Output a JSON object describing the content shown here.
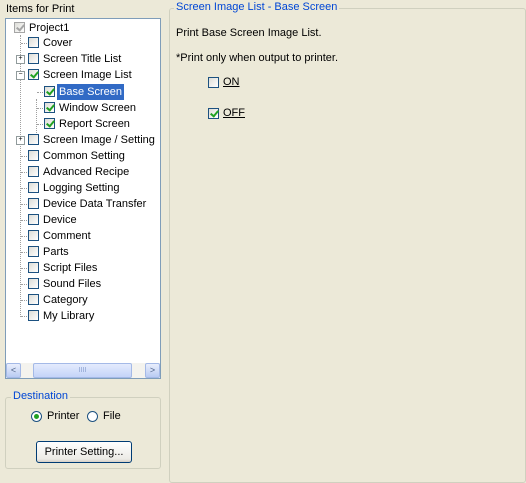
{
  "left": {
    "title": "Items for Print",
    "tree": [
      {
        "label": "Project1",
        "checked": true,
        "gray": true
      },
      {
        "label": "Cover",
        "checked": false
      },
      {
        "label": "Screen Title List",
        "checked": false
      },
      {
        "label": "Screen Image List",
        "checked": true
      },
      {
        "label": "Base Screen",
        "checked": true,
        "selected": true
      },
      {
        "label": "Window Screen",
        "checked": true
      },
      {
        "label": "Report Screen",
        "checked": true
      },
      {
        "label": "Screen Image / Setting",
        "checked": false
      },
      {
        "label": "Common Setting",
        "checked": false
      },
      {
        "label": "Advanced Recipe",
        "checked": false
      },
      {
        "label": "Logging Setting",
        "checked": false
      },
      {
        "label": "Device Data Transfer",
        "checked": false
      },
      {
        "label": "Device",
        "checked": false
      },
      {
        "label": "Comment",
        "checked": false
      },
      {
        "label": "Parts",
        "checked": false
      },
      {
        "label": "Script Files",
        "checked": false
      },
      {
        "label": "Sound Files",
        "checked": false
      },
      {
        "label": "Category",
        "checked": false
      },
      {
        "label": "My Library",
        "checked": false
      }
    ],
    "scroll": {
      "left_arrow": "<",
      "right_arrow": ">",
      "thumb_grip": "IIII"
    },
    "destination": {
      "legend": "Destination",
      "printer_label": "Printer",
      "file_label": "File",
      "selected": "Printer",
      "button_label": "Printer Setting..."
    }
  },
  "right": {
    "legend": "Screen Image List - Base Screen",
    "description": "Print Base Screen Image List.",
    "note": "*Print only when output to printer.",
    "on_label": "ON",
    "off_label": "OFF",
    "on_checked": false,
    "off_checked": true
  },
  "colors": {
    "accent": "#0046d5",
    "selection": "#316ac5",
    "check": "#21a121"
  }
}
